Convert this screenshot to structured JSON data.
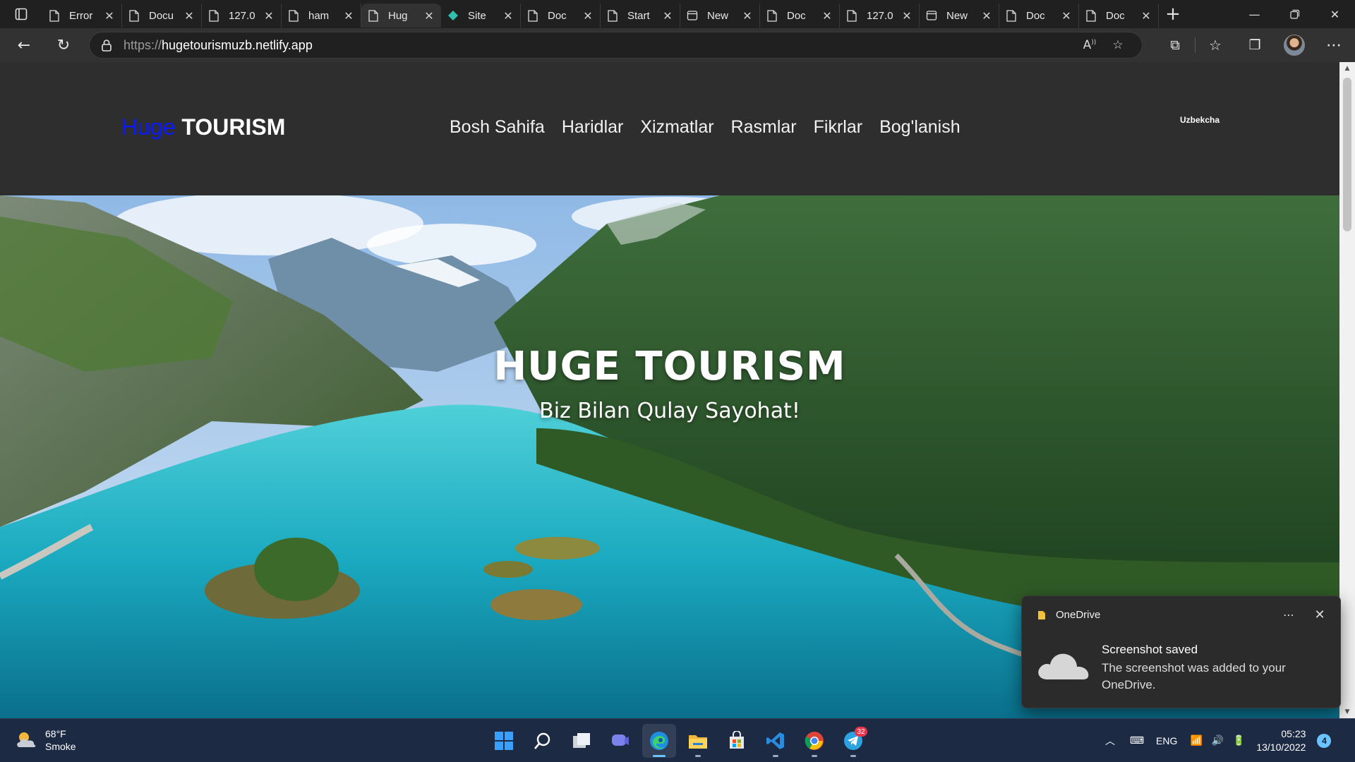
{
  "browser": {
    "tabs": [
      {
        "title": "Error",
        "icon": "page-icon",
        "active": false
      },
      {
        "title": "Docu",
        "icon": "page-icon",
        "active": false
      },
      {
        "title": "127.0",
        "icon": "page-icon",
        "active": false
      },
      {
        "title": "ham",
        "icon": "page-icon",
        "active": false
      },
      {
        "title": "Hug",
        "icon": "page-icon",
        "active": true
      },
      {
        "title": "Site",
        "icon": "netlify-icon",
        "active": false
      },
      {
        "title": "Doc",
        "icon": "page-icon",
        "active": false
      },
      {
        "title": "Start",
        "icon": "page-icon",
        "active": false
      },
      {
        "title": "New",
        "icon": "newtab-icon",
        "active": false
      },
      {
        "title": "Doc",
        "icon": "page-icon",
        "active": false
      },
      {
        "title": "127.0",
        "icon": "page-icon",
        "active": false
      },
      {
        "title": "New",
        "icon": "newtab-icon",
        "active": false
      },
      {
        "title": "Doc",
        "icon": "page-icon",
        "active": false
      },
      {
        "title": "Doc",
        "icon": "page-icon",
        "active": false
      }
    ],
    "url_scheme": "https://",
    "url_host": "hugetourismuzb.netlify.app"
  },
  "site": {
    "logo_part1": "Huge",
    "logo_part2": "TOURISM",
    "nav": [
      "Bosh Sahifa",
      "Haridlar",
      "Xizmatlar",
      "Rasmlar",
      "Fikrlar",
      "Bog'lanish"
    ],
    "language": "Uzbekcha",
    "hero_title": "HUGE TOURISM",
    "hero_subtitle": "Biz Bilan Qulay Sayohat!"
  },
  "toast": {
    "app_name": "OneDrive",
    "title": "Screenshot saved",
    "body": "The screenshot was added to your OneDrive."
  },
  "taskbar": {
    "weather_temp": "68°F",
    "weather_desc": "Smoke",
    "apps": [
      "start-icon",
      "search-icon",
      "task-view-icon",
      "chat-icon",
      "edge-icon",
      "file-explorer-icon",
      "store-icon",
      "vscode-icon",
      "chrome-icon",
      "telegram-icon"
    ],
    "telegram_badge": "32",
    "language": "ENG",
    "time": "05:23",
    "date": "13/10/2022",
    "notifications": "4"
  },
  "colors": {
    "logo_accent": "#0b19ff",
    "site_header": "#2e2e2e",
    "taskbar": "#1c2a44"
  }
}
